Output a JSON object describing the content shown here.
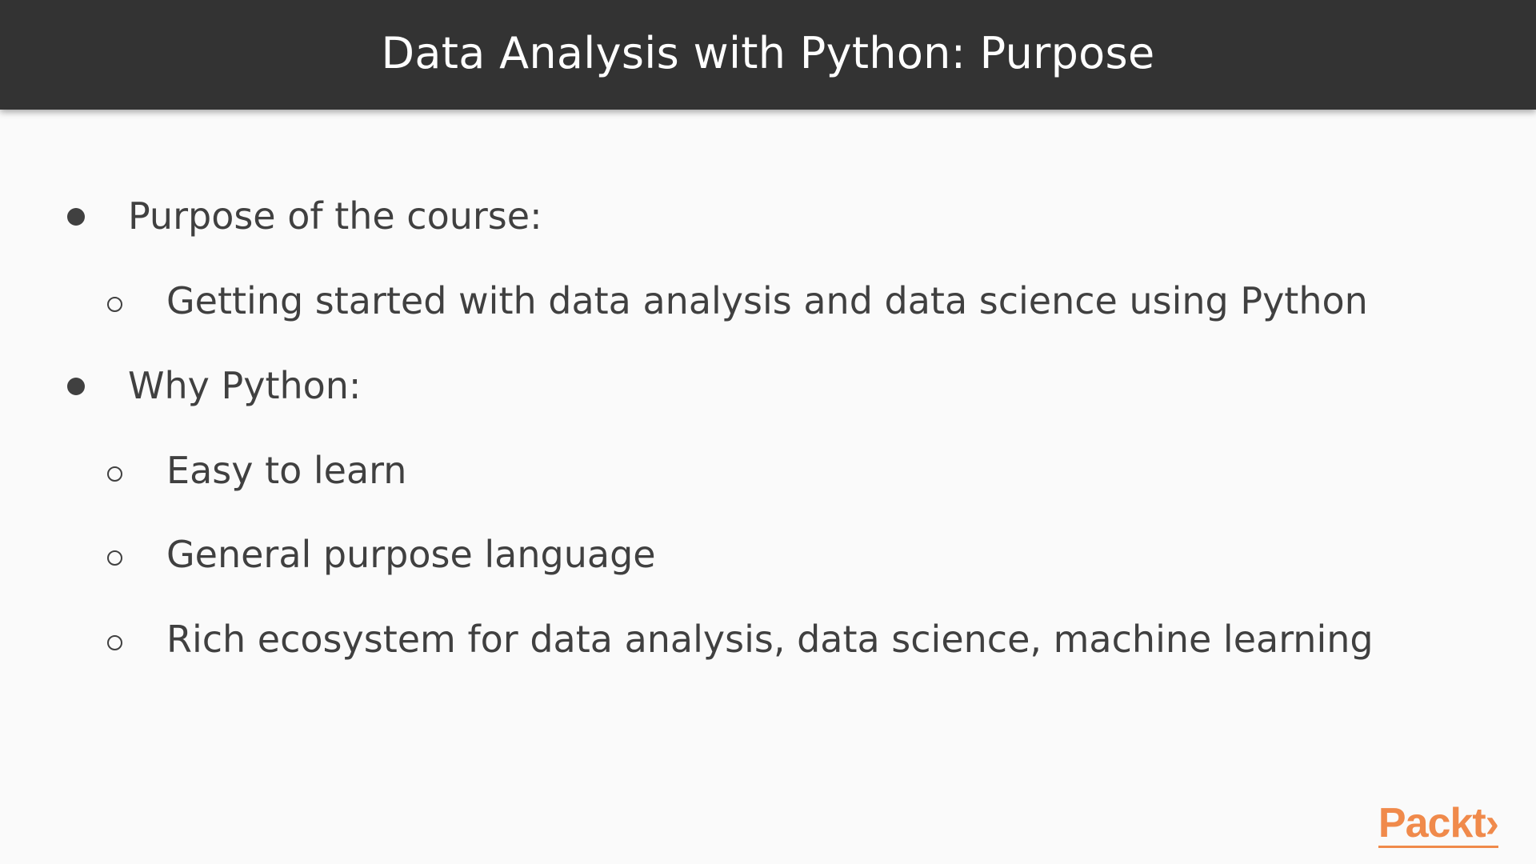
{
  "slide": {
    "title": "Data Analysis with Python: Purpose",
    "items": [
      {
        "level": 1,
        "text": "Purpose of the course:"
      },
      {
        "level": 2,
        "text": "Getting started with data analysis and data science using Python"
      },
      {
        "level": 1,
        "text": "Why Python:"
      },
      {
        "level": 2,
        "text": "Easy to learn"
      },
      {
        "level": 2,
        "text": "General purpose language"
      },
      {
        "level": 2,
        "text": "Rich ecosystem for data analysis, data science, machine learning"
      }
    ]
  },
  "logo": {
    "text": "Packt›"
  },
  "colors": {
    "header_bg": "#333333",
    "background": "#fafafa",
    "text": "#404040",
    "accent": "#f08a4b"
  }
}
